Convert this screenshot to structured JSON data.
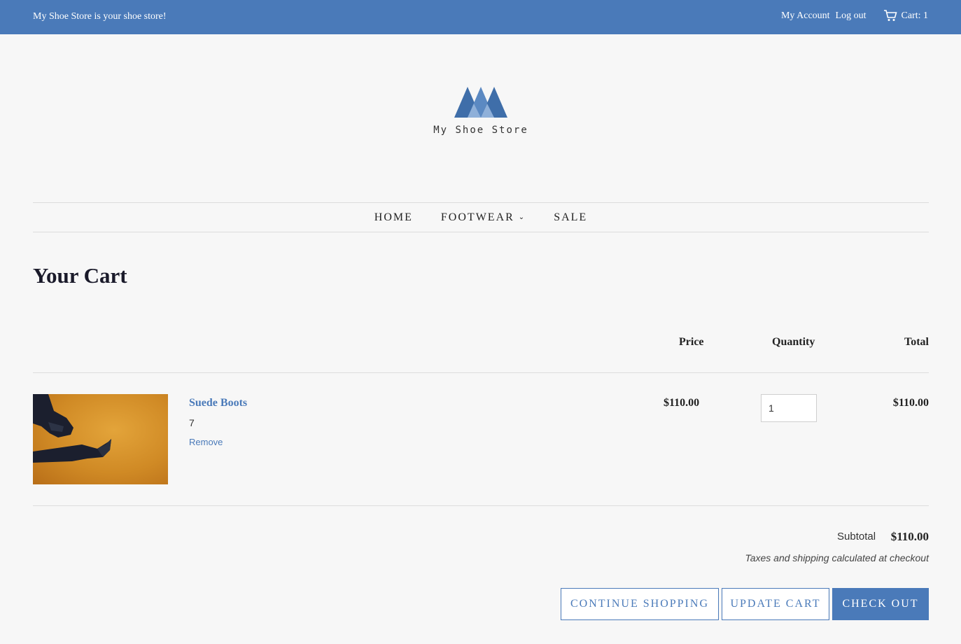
{
  "topbar": {
    "tagline": "My Shoe Store is your shoe store!",
    "account_label": "My Account",
    "logout_label": "Log out",
    "cart_label": "Cart: 1",
    "background_color": "#4a7ab9"
  },
  "logo": {
    "name": "My Shoe Store"
  },
  "nav": {
    "items": [
      {
        "label": "HOME"
      },
      {
        "label": "FOOTWEAR"
      },
      {
        "label": "SALE"
      }
    ]
  },
  "page": {
    "title": "Your Cart"
  },
  "cart": {
    "headers": {
      "price": "Price",
      "quantity": "Quantity",
      "total": "Total"
    },
    "items": [
      {
        "name": "Suede Boots",
        "variant": "7",
        "remove_label": "Remove",
        "price": "$110.00",
        "quantity": "1",
        "total": "$110.00"
      }
    ],
    "subtotal_label": "Subtotal",
    "subtotal_value": "$110.00",
    "tax_note": "Taxes and shipping calculated at checkout"
  },
  "buttons": {
    "continue": "CONTINUE SHOPPING",
    "update": "UPDATE CART",
    "checkout": "CHECK OUT"
  },
  "colors": {
    "accent": "#4a7ab9",
    "page_bg": "#f7f7f7"
  }
}
